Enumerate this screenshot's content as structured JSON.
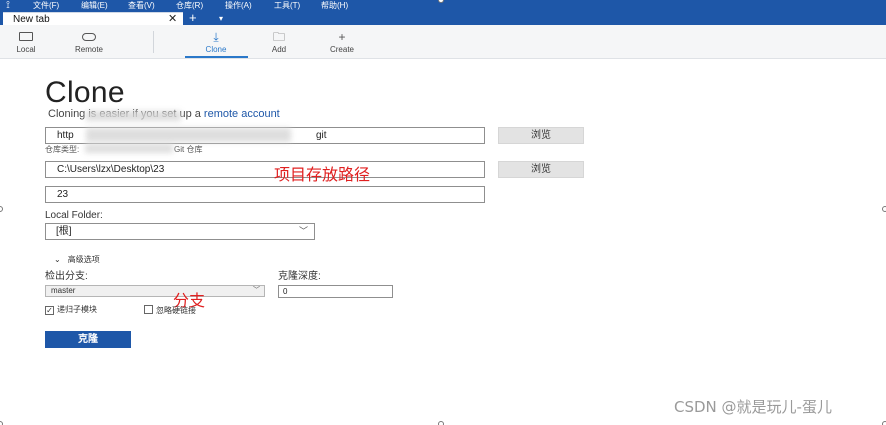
{
  "menubar": {
    "items": [
      "文件(F)",
      "编辑(E)",
      "查看(V)",
      "仓库(R)",
      "操作(A)",
      "工具(T)",
      "帮助(H)"
    ]
  },
  "tabs": {
    "items": [
      {
        "label": "New tab"
      }
    ],
    "close_glyph": "✕",
    "add_glyph": "+",
    "menu_glyph": "▾"
  },
  "toolbar": {
    "buttons": [
      {
        "label": "Local",
        "icon": "monitor-icon"
      },
      {
        "label": "Remote",
        "icon": "cloud-icon"
      },
      {
        "label": "Clone",
        "icon": "download-icon",
        "active": true
      },
      {
        "label": "Add",
        "icon": "folder-icon"
      },
      {
        "label": "Create",
        "icon": "plus-icon"
      }
    ]
  },
  "clone": {
    "title": "Clone",
    "subtitle_prefix": "Cloning is ",
    "subtitle_middle": "easier if you set up a ",
    "subtitle_link": "remote account",
    "url_value_start": "http",
    "url_value_end": "git",
    "repo_type_label": "仓库类型:",
    "repo_type_value": "Git 仓库",
    "path_value": "C:\\Users\\lzx\\Desktop\\23",
    "name_value": "23",
    "browse_label": "浏览",
    "local_folder_label": "Local Folder:",
    "local_folder_value": "[根]",
    "advanced_label": "高级选项",
    "branch_label": "检出分支:",
    "branch_value": "master",
    "depth_label": "克隆深度:",
    "depth_value": "0",
    "recurse_submodules_label": "递归子模块",
    "recurse_submodules_checked": true,
    "skip_hardlinks_label": "忽略硬链接",
    "skip_hardlinks_checked": false,
    "clone_button_label": "克隆"
  },
  "annotations": {
    "path_note": "项目存放路径",
    "branch_note": "分支"
  },
  "watermark": "CSDN @就是玩儿-蛋儿",
  "colors": {
    "accent": "#1e57a8",
    "annotation": "#e02020",
    "active_tab": "#2a78c9"
  }
}
